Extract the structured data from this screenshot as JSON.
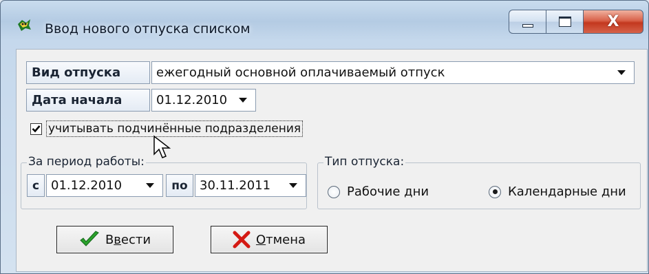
{
  "window": {
    "title": "Ввод нового отпуска списком",
    "buttons": {
      "minimize": "minimize-icon",
      "maximize": "maximize-icon",
      "close": "close-icon"
    },
    "close_glyph": "X"
  },
  "form": {
    "leave_type": {
      "label": "Вид отпуска",
      "value": "ежегодный основной оплачиваемый отпуск"
    },
    "start_date": {
      "label": "Дата начала",
      "value": "01.12.2010"
    },
    "include_subdivisions": {
      "label": "учитывать подчинённые подразделения",
      "checked": true
    }
  },
  "work_period": {
    "title": "За период работы:",
    "from_label": "с",
    "from_value": "01.12.2010",
    "to_label": "по",
    "to_value": "30.11.2011"
  },
  "leave_kind": {
    "title": "Тип отпуска:",
    "options": [
      {
        "label": "Рабочие дни",
        "selected": false
      },
      {
        "label": "Календарные дни",
        "selected": true
      }
    ]
  },
  "actions": {
    "ok": {
      "label_first": "В",
      "label_underlined": "в",
      "label_rest": "ести",
      "icon": "checkmark-icon"
    },
    "cancel": {
      "label_underlined": "О",
      "label_rest": "тмена",
      "icon": "cross-icon"
    }
  },
  "colors": {
    "title_gradient_top": "#c9dcee",
    "client_bg": "#f0f0f0",
    "close_red": "#c3381f",
    "check_green": "#2aa12b",
    "cross_red": "#d41a14"
  }
}
